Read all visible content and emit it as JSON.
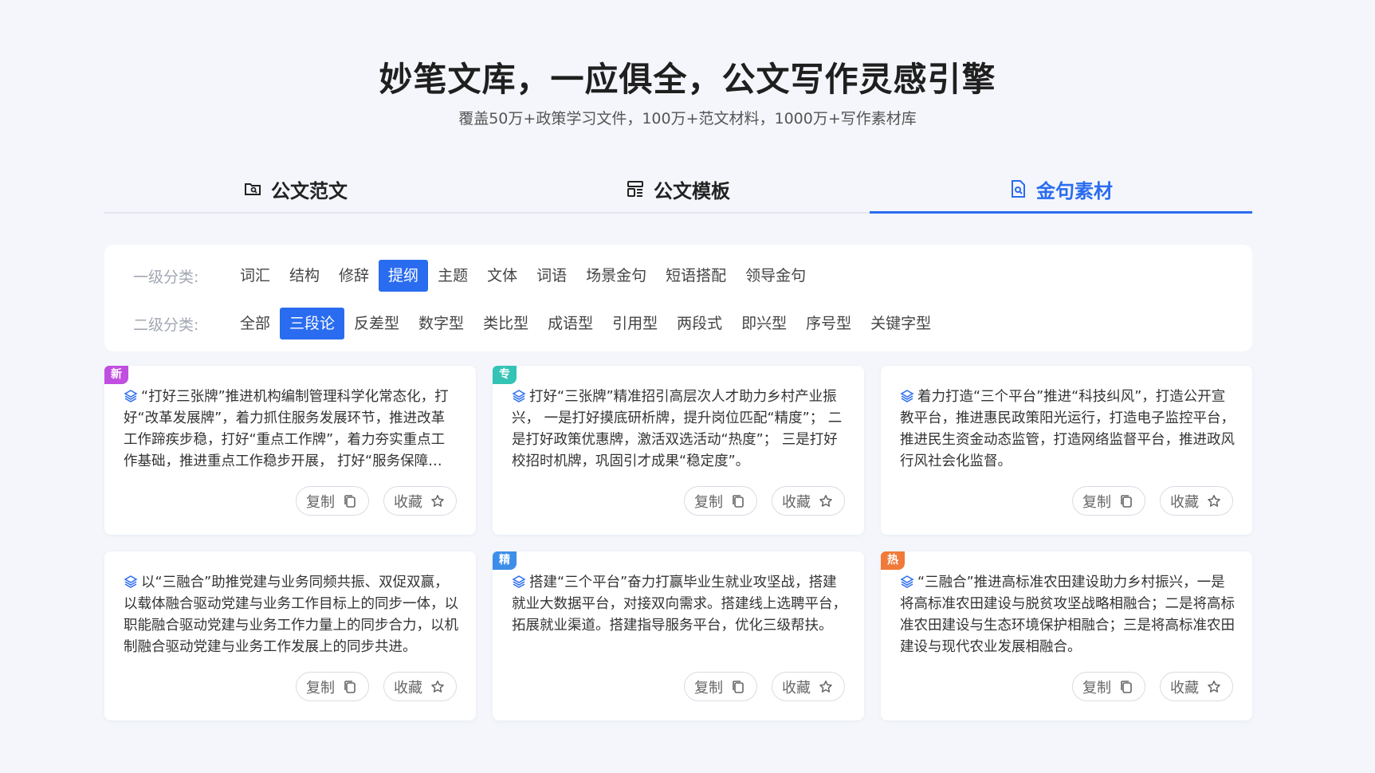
{
  "hero": {
    "title": "妙笔文库，一应俱全，公文写作灵感引擎",
    "subtitle": "覆盖50万+政策学习文件，100万+范文材料，1000万+写作素材库"
  },
  "tabs": [
    {
      "label": "公文范文",
      "icon": "folder-icon",
      "active": false
    },
    {
      "label": "公文模板",
      "icon": "template-icon",
      "active": false
    },
    {
      "label": "金句素材",
      "icon": "document-search-icon",
      "active": true
    }
  ],
  "filters": {
    "level1_label": "一级分类:",
    "level1": [
      "词汇",
      "结构",
      "修辞",
      "提纲",
      "主题",
      "文体",
      "词语",
      "场景金句",
      "短语搭配",
      "领导金句"
    ],
    "level1_active": 3,
    "level2_label": "二级分类:",
    "level2": [
      "全部",
      "三段论",
      "反差型",
      "数字型",
      "类比型",
      "成语型",
      "引用型",
      "两段式",
      "即兴型",
      "序号型",
      "关键字型"
    ],
    "level2_active": 1
  },
  "cards": [
    {
      "badge": "新",
      "badge_color": "#c04ee0",
      "text": "“打好三张牌”推进机构编制管理科学化常态化，打好“改革发展牌”，着力抓住服务发展环节，推进改革工作蹄疾步稳，打好“重点工作牌”，着力夯实重点工作基础，推进重点工作稳步开展， 打好“服务保障牌”，着力提升服务保障能力。"
    },
    {
      "badge": "专",
      "badge_color": "#34c3b5",
      "text": "打好“三张牌”精准招引高层次人才助力乡村产业振兴， 一是打好摸底研析牌，提升岗位匹配“精度”； 二是打好政策优惠牌，激活双选活动“热度”； 三是打好校招时机牌，巩固引才成果“稳定度”。"
    },
    {
      "badge": "",
      "badge_color": "",
      "text": "着力打造“三个平台”推进“科技纠风”，打造公开宣教平台，推进惠民政策阳光运行，打造电子监控平台，推进民生资金动态监管，打造网络监督平台，推进政风行风社会化监督。"
    },
    {
      "badge": "",
      "badge_color": "",
      "text": "以“三融合”助推党建与业务同频共振、双促双赢，以载体融合驱动党建与业务工作目标上的同步一体，以职能融合驱动党建与业务工作力量上的同步合力，以机制融合驱动党建与业务工作发展上的同步共进。"
    },
    {
      "badge": "精",
      "badge_color": "#3d8ee8",
      "text": "搭建“三个平台”奋力打赢毕业生就业攻坚战，搭建就业大数据平台，对接双向需求。搭建线上选聘平台，拓展就业渠道。搭建指导服务平台，优化三级帮扶。"
    },
    {
      "badge": "热",
      "badge_color": "#f07a3a",
      "text": "“三融合”推进高标准农田建设助力乡村振兴，一是将高标准农田建设与脱贫攻坚战略相融合；二是将高标准农田建设与生态环境保护相融合；三是将高标准农田建设与现代农业发展相融合。"
    }
  ],
  "buttons": {
    "copy": "复制",
    "favorite": "收藏"
  }
}
